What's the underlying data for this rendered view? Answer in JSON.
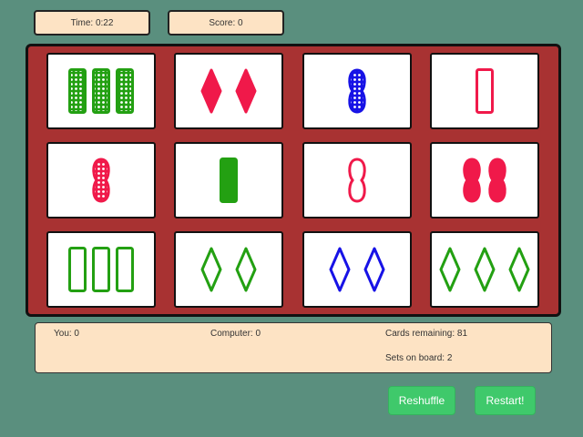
{
  "header": {
    "time_label": "Time: 0:22",
    "score_label": "Score: 0"
  },
  "colors": {
    "green": "#23a012",
    "red": "#f0194a",
    "blue": "#1712e6",
    "board": "#a83232",
    "panel": "#fde3c4",
    "button": "#3fc96b",
    "background": "#5a8f7e"
  },
  "cards": [
    {
      "count": 3,
      "shape": "rectangle",
      "fill": "dotted",
      "color": "green"
    },
    {
      "count": 2,
      "shape": "diamond",
      "fill": "solid",
      "color": "red"
    },
    {
      "count": 1,
      "shape": "peanut",
      "fill": "dotted",
      "color": "blue"
    },
    {
      "count": 1,
      "shape": "rectangle",
      "fill": "outline",
      "color": "red"
    },
    {
      "count": 1,
      "shape": "peanut",
      "fill": "dotted",
      "color": "red"
    },
    {
      "count": 1,
      "shape": "rectangle",
      "fill": "solid",
      "color": "green"
    },
    {
      "count": 1,
      "shape": "peanut",
      "fill": "outline",
      "color": "red"
    },
    {
      "count": 2,
      "shape": "peanut",
      "fill": "solid",
      "color": "red"
    },
    {
      "count": 3,
      "shape": "rectangle",
      "fill": "outline",
      "color": "green"
    },
    {
      "count": 2,
      "shape": "diamond",
      "fill": "outline",
      "color": "green"
    },
    {
      "count": 2,
      "shape": "diamond",
      "fill": "outline",
      "color": "blue"
    },
    {
      "count": 3,
      "shape": "diamond",
      "fill": "outline",
      "color": "green"
    }
  ],
  "info": {
    "you_label": "You: 0",
    "computer_label": "Computer: 0",
    "cards_remaining_label": "Cards remaining: 81",
    "sets_on_board_label": "Sets on board: 2"
  },
  "buttons": {
    "reshuffle_label": "Reshuffle",
    "restart_label": "Restart!"
  }
}
